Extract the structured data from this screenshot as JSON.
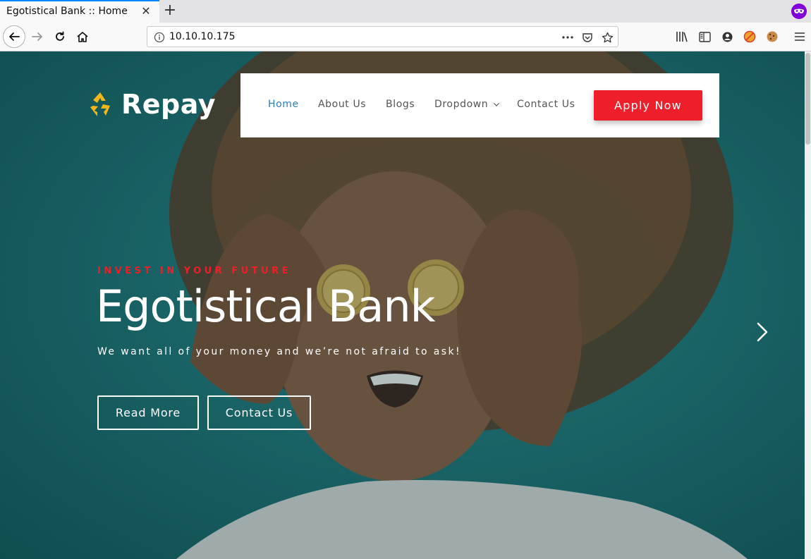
{
  "browser": {
    "tab_title": "Egotistical Bank :: Home",
    "tab_close": "✕",
    "new_tab": "+",
    "url": "10.10.10.175"
  },
  "site": {
    "logo_text": "Repay",
    "nav": [
      {
        "label": "Home"
      },
      {
        "label": "About Us"
      },
      {
        "label": "Blogs"
      },
      {
        "label": "Dropdown"
      },
      {
        "label": "Contact Us"
      }
    ],
    "apply_label": "Apply Now"
  },
  "hero": {
    "kicker": "INVEST IN YOUR FUTURE",
    "title": "Egotistical Bank",
    "subtitle": "We want all of your money and we’re not afraid to ask!",
    "read_more": "Read More",
    "contact": "Contact Us"
  },
  "colors": {
    "accent_red": "#ee1e2a",
    "nav_active": "#2f7fbf",
    "hero_bg": "#1f7173",
    "tab_highlight": "#0a84ff"
  },
  "icons": [
    "back-icon",
    "forward-icon",
    "reload-icon",
    "home-icon",
    "info-icon",
    "more-icon",
    "pocket-icon",
    "bookmark-star-icon",
    "library-icon",
    "sidebar-icon",
    "account-icon",
    "addon-icon",
    "cookie-icon",
    "menu-icon",
    "private-mask-icon",
    "recycle-logo-icon",
    "chevron-down-icon",
    "chevron-right-icon"
  ]
}
